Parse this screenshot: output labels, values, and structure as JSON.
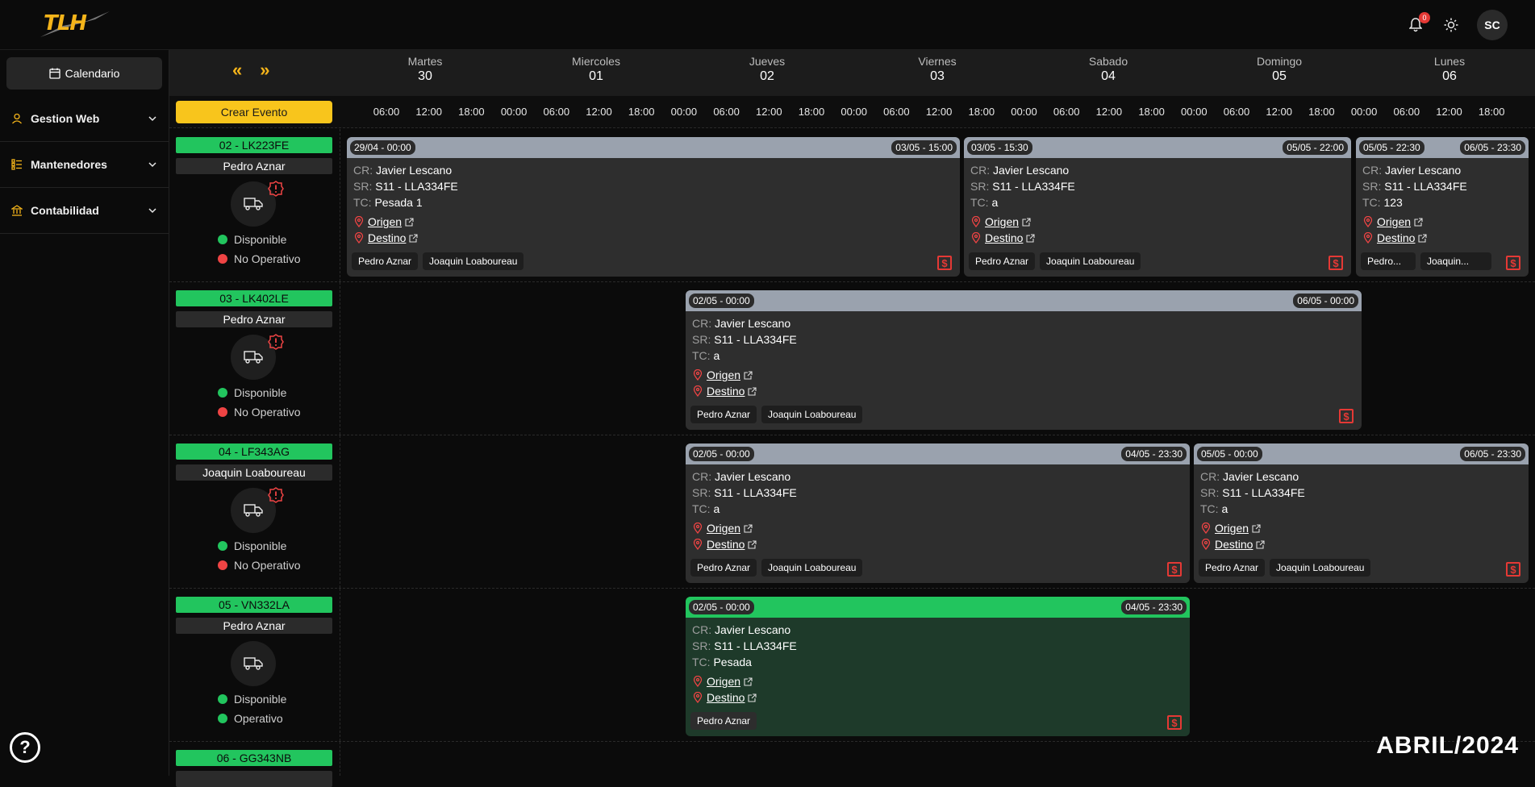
{
  "app": {
    "logo_text": "TLH"
  },
  "topbar": {
    "notification_count": "0",
    "avatar_initials": "SC"
  },
  "sidebar": {
    "calendar_label": "Calendario",
    "items": [
      {
        "label": "Gestion Web",
        "icon": "user-icon"
      },
      {
        "label": "Mantenedores",
        "icon": "list-icon"
      },
      {
        "label": "Contabilidad",
        "icon": "bank-icon"
      }
    ],
    "help_label": "?"
  },
  "calendar": {
    "prev_label": "«",
    "next_label": "»",
    "create_label": "Crear Evento",
    "month_label": "ABRIL/2024",
    "days": [
      {
        "name": "Martes",
        "num": "30"
      },
      {
        "name": "Miercoles",
        "num": "01"
      },
      {
        "name": "Jueves",
        "num": "02"
      },
      {
        "name": "Viernes",
        "num": "03"
      },
      {
        "name": "Sabado",
        "num": "04"
      },
      {
        "name": "Domingo",
        "num": "05"
      },
      {
        "name": "Lunes",
        "num": "06"
      }
    ],
    "ticks": [
      "06:00",
      "12:00",
      "18:00",
      "00:00",
      "06:00",
      "12:00",
      "18:00",
      "00:00",
      "06:00",
      "12:00",
      "18:00",
      "00:00",
      "06:00",
      "12:00",
      "18:00",
      "00:00",
      "06:00",
      "12:00",
      "18:00",
      "00:00",
      "06:00",
      "12:00",
      "18:00",
      "00:00",
      "06:00",
      "12:00",
      "18:00"
    ]
  },
  "rows": [
    {
      "plate": "02 - LK223FE",
      "driver": "Pedro Aznar",
      "alert": true,
      "status1": "Disponible",
      "status2": "No Operativo",
      "status2_color": "red",
      "events": [
        {
          "start": "29/04 - 00:00",
          "end": "03/05 - 15:00",
          "cr": "Javier Lescano",
          "sr": "S11 - LLA334FE",
          "tc": "Pesada 1",
          "origen": "Origen",
          "destino": "Destino",
          "chips": [
            "Pedro Aznar",
            "Joaquin Loaboureau"
          ],
          "green": false
        },
        {
          "start": "03/05 - 15:30",
          "end": "05/05 - 22:00",
          "cr": "Javier Lescano",
          "sr": "S11 - LLA334FE",
          "tc": "a",
          "origen": "Origen",
          "destino": "Destino",
          "chips": [
            "Pedro Aznar",
            "Joaquin Loaboureau"
          ],
          "green": false
        },
        {
          "start": "05/05 - 22:30",
          "end": "06/05 - 23:30",
          "cr": "Javier Lescano",
          "sr": "S11 - LLA334FE",
          "tc": "123",
          "origen": "Origen",
          "destino": "Destino",
          "chips": [
            "Pedro...",
            "Joaquin..."
          ],
          "green": false
        }
      ]
    },
    {
      "plate": "03 - LK402LE",
      "driver": "Pedro Aznar",
      "alert": true,
      "status1": "Disponible",
      "status2": "No Operativo",
      "status2_color": "red",
      "events": [
        {
          "start": "02/05 - 00:00",
          "end": "06/05 - 00:00",
          "cr": "Javier Lescano",
          "sr": "S11 - LLA334FE",
          "tc": "a",
          "origen": "Origen",
          "destino": "Destino",
          "chips": [
            "Pedro Aznar",
            "Joaquin Loaboureau"
          ],
          "green": false
        }
      ]
    },
    {
      "plate": "04 - LF343AG",
      "driver": "Joaquin Loaboureau",
      "alert": true,
      "status1": "Disponible",
      "status2": "No Operativo",
      "status2_color": "red",
      "events": [
        {
          "start": "02/05 - 00:00",
          "end": "04/05 - 23:30",
          "cr": "Javier Lescano",
          "sr": "S11 - LLA334FE",
          "tc": "a",
          "origen": "Origen",
          "destino": "Destino",
          "chips": [
            "Pedro Aznar",
            "Joaquin Loaboureau"
          ],
          "green": false
        },
        {
          "start": "05/05 - 00:00",
          "end": "06/05 - 23:30",
          "cr": "Javier Lescano",
          "sr": "S11 - LLA334FE",
          "tc": "a",
          "origen": "Origen",
          "destino": "Destino",
          "chips": [
            "Pedro Aznar",
            "Joaquin Loaboureau"
          ],
          "green": false
        }
      ]
    },
    {
      "plate": "05 - VN332LA",
      "driver": "Pedro Aznar",
      "alert": false,
      "status1": "Disponible",
      "status2": "Operativo",
      "status2_color": "green",
      "events": [
        {
          "start": "02/05 - 00:00",
          "end": "04/05 - 23:30",
          "cr": "Javier Lescano",
          "sr": "S11 - LLA334FE",
          "tc": "Pesada",
          "origen": "Origen",
          "destino": "Destino",
          "chips": [
            "Pedro Aznar"
          ],
          "green": true
        }
      ]
    },
    {
      "plate": "06 - GG343NB"
    }
  ],
  "labels": {
    "cr": "CR:",
    "sr": "SR:",
    "tc": "TC:"
  }
}
